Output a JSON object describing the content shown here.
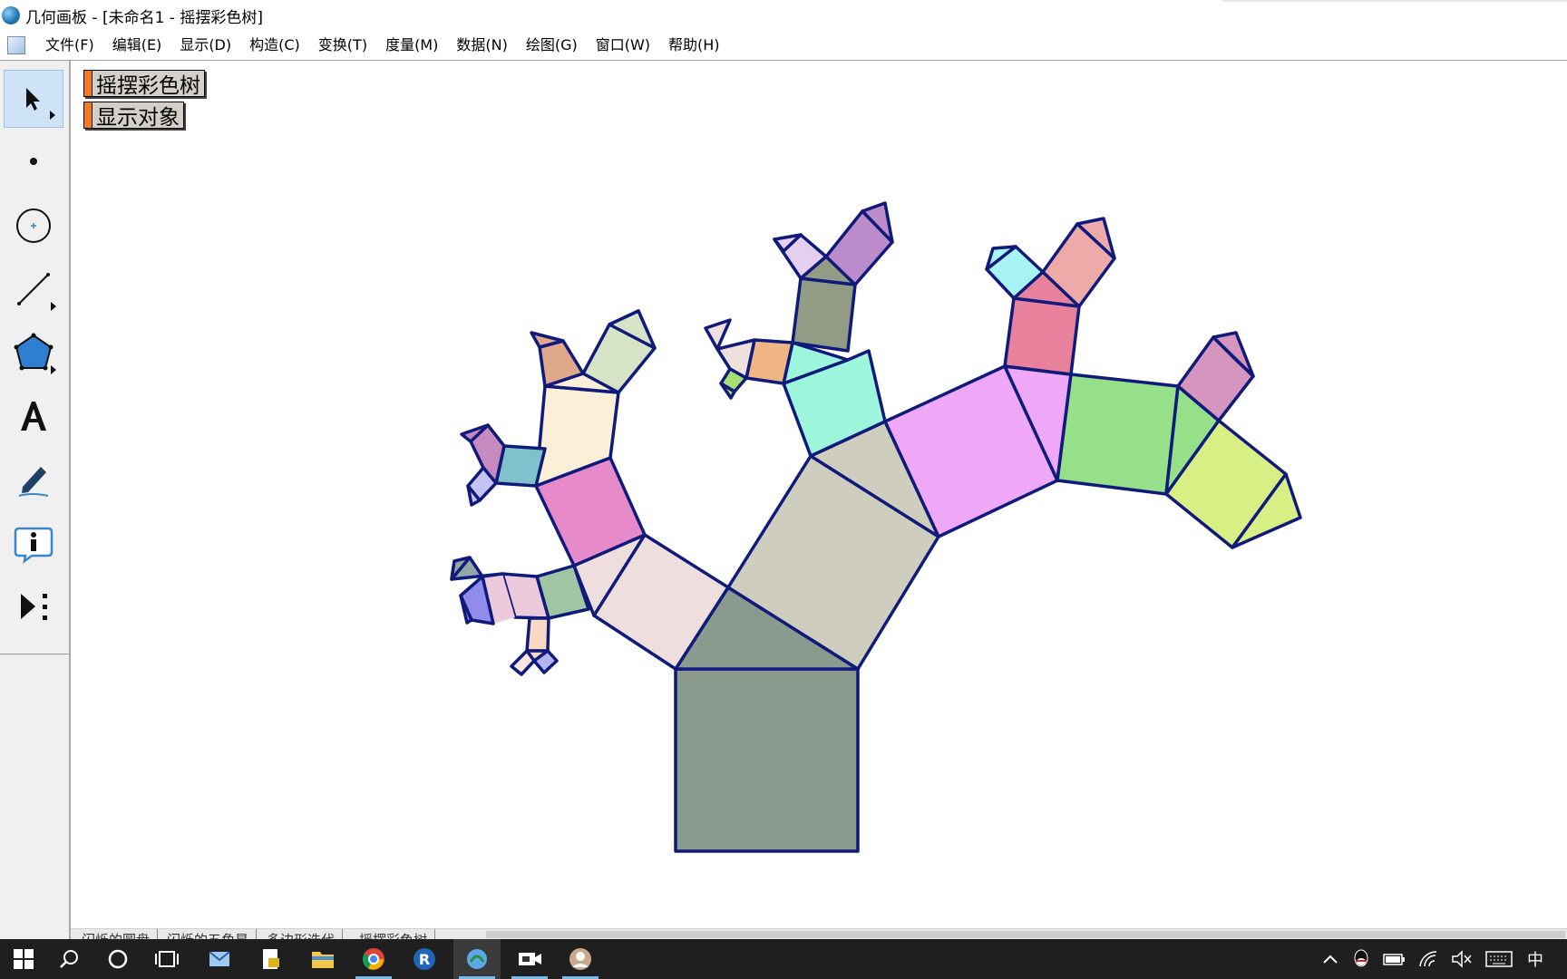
{
  "window": {
    "title": "几何画板 - [未命名1 - 摇摆彩色树]"
  },
  "menu": [
    "文件(F)",
    "编辑(E)",
    "显示(D)",
    "构造(C)",
    "变换(T)",
    "度量(M)",
    "数据(N)",
    "绘图(G)",
    "窗口(W)",
    "帮助(H)"
  ],
  "toolbox": {
    "tools": [
      "selection-arrow-tool",
      "point-tool",
      "compass-tool",
      "straightedge-tool",
      "polygon-tool",
      "text-tool",
      "marker-tool",
      "information-tool",
      "custom-tools"
    ]
  },
  "canvas": {
    "buttons": [
      "摇摆彩色树",
      "显示对象"
    ]
  },
  "tabs": [
    "闪烁的圆盘",
    "闪烁的五角星",
    "多边形迭代",
    "摇摆彩色树"
  ],
  "taskbar": {
    "apps": [
      "start-icon",
      "search-icon",
      "cortana-icon",
      "task-view-icon",
      "mail-app-icon",
      "document-app-icon",
      "file-explorer-icon",
      "chrome-icon",
      "r-app-icon",
      "sketchpad-app-icon",
      "video-app-icon",
      "avatar-app-icon"
    ],
    "tray": [
      "chevron-up-icon",
      "qq-icon",
      "battery-icon",
      "wifi-icon",
      "volume-mute-icon",
      "keyboard-icon"
    ],
    "ime": "中"
  },
  "colors": {
    "outline": "#0f1a7a",
    "button_handle": "#f47a1c",
    "button_face": "#d4d0c8",
    "taskbar": "#1f1f1f"
  }
}
